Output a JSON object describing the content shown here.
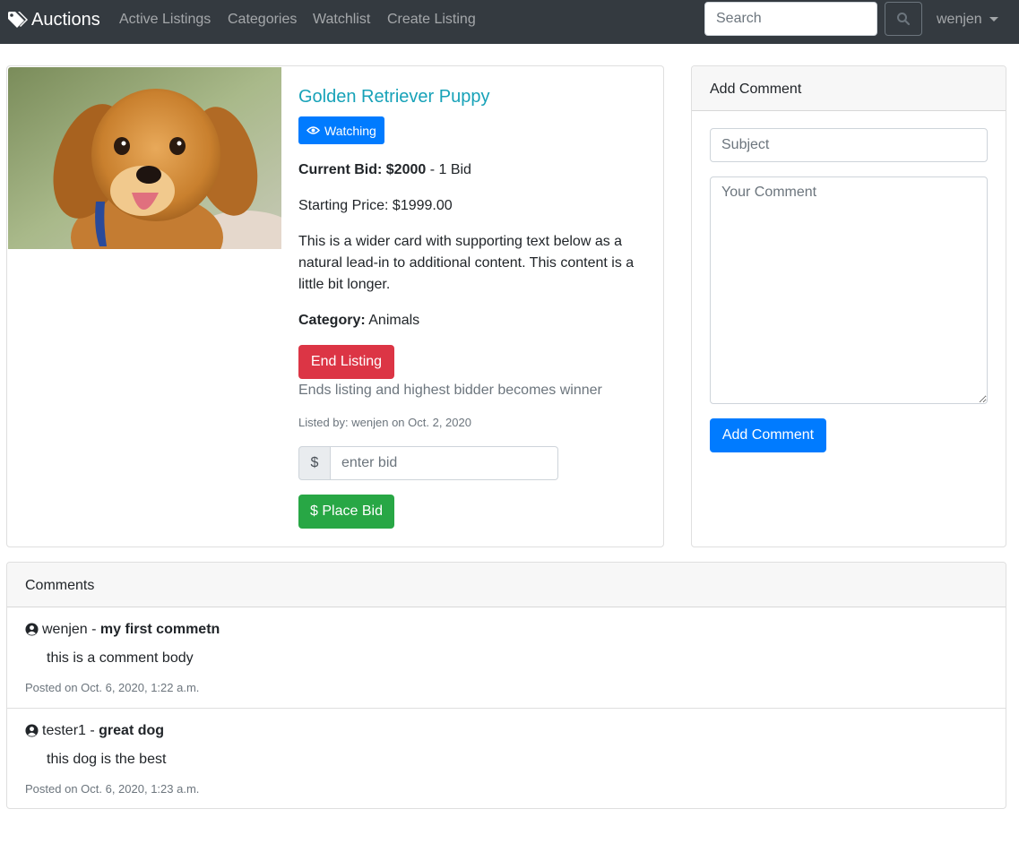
{
  "nav": {
    "brand": "Auctions",
    "links": [
      "Active Listings",
      "Categories",
      "Watchlist",
      "Create Listing"
    ],
    "search_placeholder": "Search",
    "user": "wenjen"
  },
  "listing": {
    "title": "Golden Retriever Puppy",
    "watch_label": "Watching",
    "current_bid_label": "Current Bid: $2000",
    "bid_count": " - 1 Bid",
    "starting_price": "Starting Price: $1999.00",
    "description": "This is a wider card with supporting text below as a natural lead-in to additional content. This content is a little bit longer.",
    "category_label": "Category:",
    "category_value": " Animals",
    "end_button": "End Listing",
    "end_help": "Ends listing and highest bidder becomes winner",
    "listed_by": "Listed by: wenjen on Oct. 2, 2020",
    "bid_prefix": "$",
    "bid_placeholder": "enter bid",
    "place_bid_button": "$ Place Bid"
  },
  "comment_form": {
    "header": "Add Comment",
    "subject_placeholder": "Subject",
    "comment_placeholder": "Your Comment",
    "submit_button": "Add Comment"
  },
  "comments": {
    "header": "Comments",
    "items": [
      {
        "author": "wenjen",
        "separator": " - ",
        "subject": "my first commetn",
        "body": "this is a comment body",
        "date": "Posted on Oct. 6, 2020, 1:22 a.m."
      },
      {
        "author": "tester1",
        "separator": " - ",
        "subject": "great dog",
        "body": "this dog is the best",
        "date": "Posted on Oct. 6, 2020, 1:23 a.m."
      }
    ]
  },
  "colors": {
    "navbar": "#343a40",
    "primary": "#007bff",
    "danger": "#dc3545",
    "success": "#28a745",
    "title": "#17a2b8"
  }
}
